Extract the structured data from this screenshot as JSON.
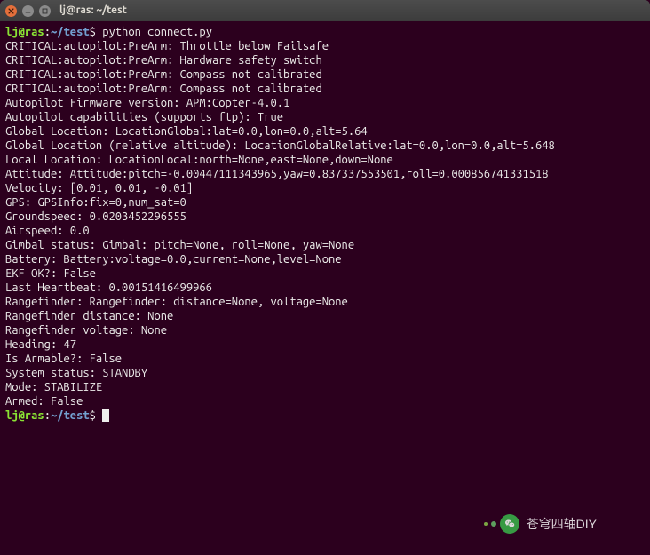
{
  "titlebar": {
    "title": "lj@ras: ~/test"
  },
  "prompt": {
    "user": "lj",
    "at": "@",
    "host": "ras",
    "colon": ":",
    "path": "~/test",
    "symbol": "$"
  },
  "command": "python connect.py",
  "output_lines": [
    "CRITICAL:autopilot:PreArm: Throttle below Failsafe",
    "CRITICAL:autopilot:PreArm: Hardware safety switch",
    "CRITICAL:autopilot:PreArm: Compass not calibrated",
    "CRITICAL:autopilot:PreArm: Compass not calibrated",
    "Autopilot Firmware version: APM:Copter-4.0.1",
    "Autopilot capabilities (supports ftp): True",
    "Global Location: LocationGlobal:lat=0.0,lon=0.0,alt=5.64",
    "Global Location (relative altitude): LocationGlobalRelative:lat=0.0,lon=0.0,alt=5.648",
    "Local Location: LocationLocal:north=None,east=None,down=None",
    "Attitude: Attitude:pitch=-0.00447111343965,yaw=0.837337553501,roll=0.000856741331518",
    "Velocity: [0.01, 0.01, -0.01]",
    "GPS: GPSInfo:fix=0,num_sat=0",
    "Groundspeed: 0.0203452296555",
    "Airspeed: 0.0",
    "Gimbal status: Gimbal: pitch=None, roll=None, yaw=None",
    "Battery: Battery:voltage=0.0,current=None,level=None",
    "EKF OK?: False",
    "Last Heartbeat: 0.00151416499966",
    "Rangefinder: Rangefinder: distance=None, voltage=None",
    "Rangefinder distance: None",
    "Rangefinder voltage: None",
    "Heading: 47",
    "Is Armable?: False",
    "System status: STANDBY",
    "Mode: STABILIZE",
    "Armed: False"
  ],
  "watermark": {
    "text": "苍穹四轴DIY"
  }
}
